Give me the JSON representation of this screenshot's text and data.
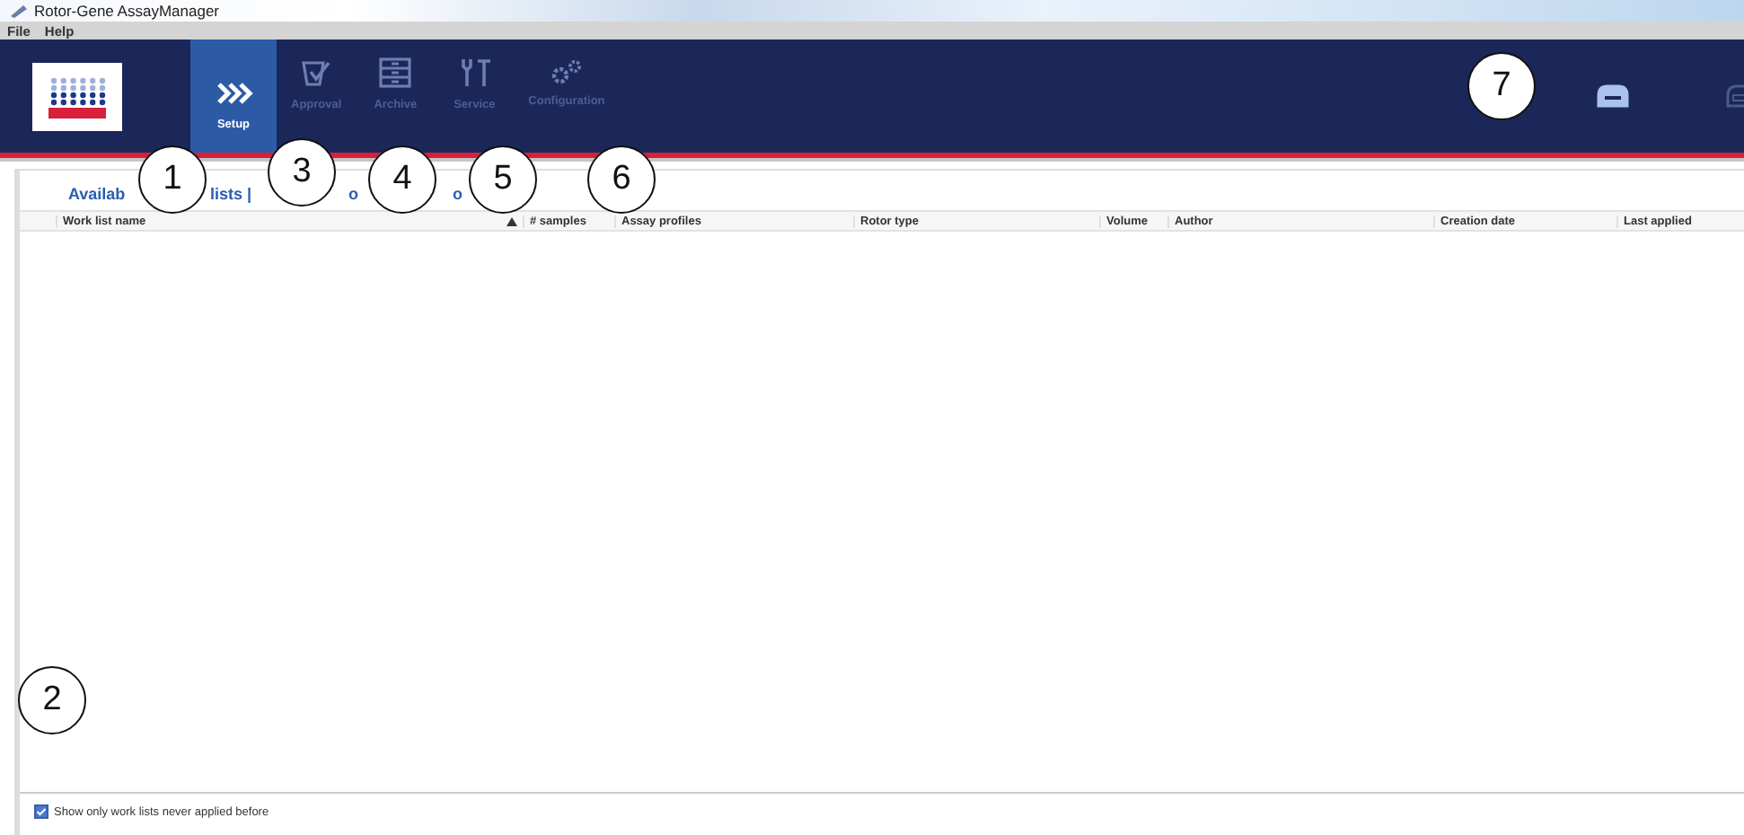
{
  "window": {
    "title": "Rotor-Gene AssayManager"
  },
  "menu": [
    "File",
    "Help"
  ],
  "nav": [
    {
      "label": "Setup",
      "kind": "setup",
      "selected": true
    },
    {
      "label": "Approval",
      "kind": "approval",
      "selected": false
    },
    {
      "label": "Archive",
      "kind": "archive",
      "selected": false
    },
    {
      "label": "Service",
      "kind": "service",
      "selected": false
    },
    {
      "label": "Configuration",
      "kind": "configuration",
      "selected": false
    }
  ],
  "instruments": [
    {
      "disabled": false
    },
    {
      "disabled": true
    }
  ],
  "subtabs": [
    "Availab",
    "lists |",
    "o",
    "o"
  ],
  "table": {
    "columns": [
      {
        "label": "Work list name",
        "sorted": true
      },
      {
        "label": "# samples",
        "sorted": false
      },
      {
        "label": "Assay profiles",
        "sorted": false
      },
      {
        "label": "Rotor type",
        "sorted": false
      },
      {
        "label": "Volume",
        "sorted": false
      },
      {
        "label": "Author",
        "sorted": false
      },
      {
        "label": "Creation date",
        "sorted": false
      },
      {
        "label": "Last applied",
        "sorted": false
      }
    ]
  },
  "filter": {
    "label": "Show only work lists never applied before",
    "checked": true
  },
  "callouts": [
    "1",
    "3",
    "4",
    "5",
    "6",
    "7",
    "2"
  ]
}
